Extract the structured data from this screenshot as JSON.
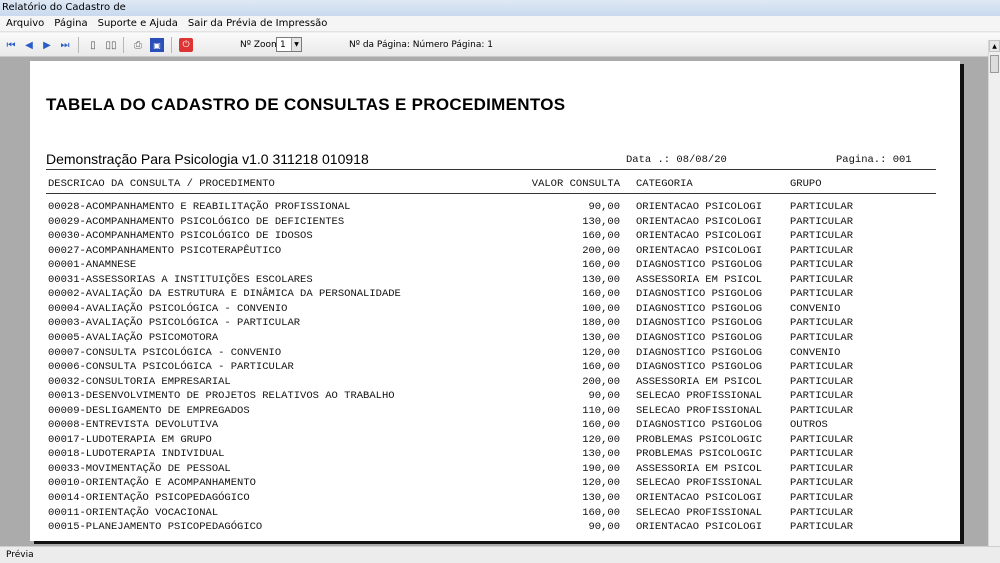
{
  "window": {
    "title": "Relatório do Cadastro de"
  },
  "menu": [
    "Arquivo",
    "Página",
    "Suporte e Ajuda",
    "Sair da Prévia de Impressão"
  ],
  "toolbar": {
    "zoom_label": "Nº Zoom",
    "zoom_value": "1",
    "page_label": "Nº da Página: Número Página: 1",
    "icons": [
      "first-page-icon",
      "prev-page-icon",
      "next-page-icon",
      "last-page-icon",
      "single-page-icon",
      "two-pages-icon",
      "print-setup-icon",
      "save-icon",
      "close-preview-icon"
    ]
  },
  "report": {
    "title": "TABELA DO CADASTRO DE CONSULTAS E PROCEDIMENTOS",
    "company": "Demonstração Para Psicologia v1.0 311218 010918",
    "date": "Data .: 08/08/20",
    "page": "Pagina.: 001",
    "columns": [
      "DESCRICAO DA CONSULTA / PROCEDIMENTO",
      "VALOR CONSULTA",
      "CATEGORIA",
      "GRUPO"
    ],
    "rows": [
      [
        "00028-ACOMPANHAMENTO E REABILITAÇÃO PROFISSIONAL",
        "90,00",
        "ORIENTACAO PSICOLOGI",
        "PARTICULAR"
      ],
      [
        "00029-ACOMPANHAMENTO PSICOLÓGICO DE DEFICIENTES",
        "130,00",
        "ORIENTACAO PSICOLOGI",
        "PARTICULAR"
      ],
      [
        "00030-ACOMPANHAMENTO PSICOLÓGICO DE IDOSOS",
        "160,00",
        "ORIENTACAO PSICOLOGI",
        "PARTICULAR"
      ],
      [
        "00027-ACOMPANHAMENTO PSICOTERAPÊUTICO",
        "200,00",
        "ORIENTACAO PSICOLOGI",
        "PARTICULAR"
      ],
      [
        "00001-ANAMNESE",
        "160,00",
        "DIAGNOSTICO PSIGOLOG",
        "PARTICULAR"
      ],
      [
        "00031-ASSESSORIAS A INSTITUIÇÕES ESCOLARES",
        "130,00",
        "ASSESSORIA EM PSICOL",
        "PARTICULAR"
      ],
      [
        "00002-AVALIAÇÃO DA ESTRUTURA E DINÂMICA DA PERSONALIDADE",
        "160,00",
        "DIAGNOSTICO PSIGOLOG",
        "PARTICULAR"
      ],
      [
        "00004-AVALIAÇÃO PSICOLÓGICA - CONVENIO",
        "100,00",
        "DIAGNOSTICO PSIGOLOG",
        "CONVENIO"
      ],
      [
        "00003-AVALIAÇÃO PSICOLÓGICA - PARTICULAR",
        "180,00",
        "DIAGNOSTICO PSIGOLOG",
        "PARTICULAR"
      ],
      [
        "00005-AVALIAÇÃO PSICOMOTORA",
        "130,00",
        "DIAGNOSTICO PSIGOLOG",
        "PARTICULAR"
      ],
      [
        "00007-CONSULTA PSICOLÓGICA - CONVENIO",
        "120,00",
        "DIAGNOSTICO PSIGOLOG",
        "CONVENIO"
      ],
      [
        "00006-CONSULTA PSICOLÓGICA - PARTICULAR",
        "160,00",
        "DIAGNOSTICO PSIGOLOG",
        "PARTICULAR"
      ],
      [
        "00032-CONSULTORIA EMPRESARIAL",
        "200,00",
        "ASSESSORIA EM PSICOL",
        "PARTICULAR"
      ],
      [
        "00013-DESENVOLVIMENTO DE PROJETOS RELATIVOS AO TRABALHO",
        "90,00",
        "SELECAO PROFISSIONAL",
        "PARTICULAR"
      ],
      [
        "00009-DESLIGAMENTO DE EMPREGADOS",
        "110,00",
        "SELECAO PROFISSIONAL",
        "PARTICULAR"
      ],
      [
        "00008-ENTREVISTA DEVOLUTIVA",
        "160,00",
        "DIAGNOSTICO PSIGOLOG",
        "OUTROS"
      ],
      [
        "00017-LUDOTERAPIA EM GRUPO",
        "120,00",
        "PROBLEMAS PSICOLOGIC",
        "PARTICULAR"
      ],
      [
        "00018-LUDOTERAPIA INDIVIDUAL",
        "130,00",
        "PROBLEMAS PSICOLOGIC",
        "PARTICULAR"
      ],
      [
        "00033-MOVIMENTAÇÃO DE PESSOAL",
        "190,00",
        "ASSESSORIA EM PSICOL",
        "PARTICULAR"
      ],
      [
        "00010-ORIENTAÇÃO E ACOMPANHAMENTO",
        "120,00",
        "SELECAO PROFISSIONAL",
        "PARTICULAR"
      ],
      [
        "00014-ORIENTAÇÃO PSICOPEDAGÓGICO",
        "130,00",
        "ORIENTACAO PSICOLOGI",
        "PARTICULAR"
      ],
      [
        "00011-ORIENTAÇÃO VOCACIONAL",
        "160,00",
        "SELECAO PROFISSIONAL",
        "PARTICULAR"
      ],
      [
        "00015-PLANEJAMENTO PSICOPEDAGÓGICO",
        "90,00",
        "ORIENTACAO PSICOLOGI",
        "PARTICULAR"
      ]
    ]
  },
  "status": "Prévia"
}
